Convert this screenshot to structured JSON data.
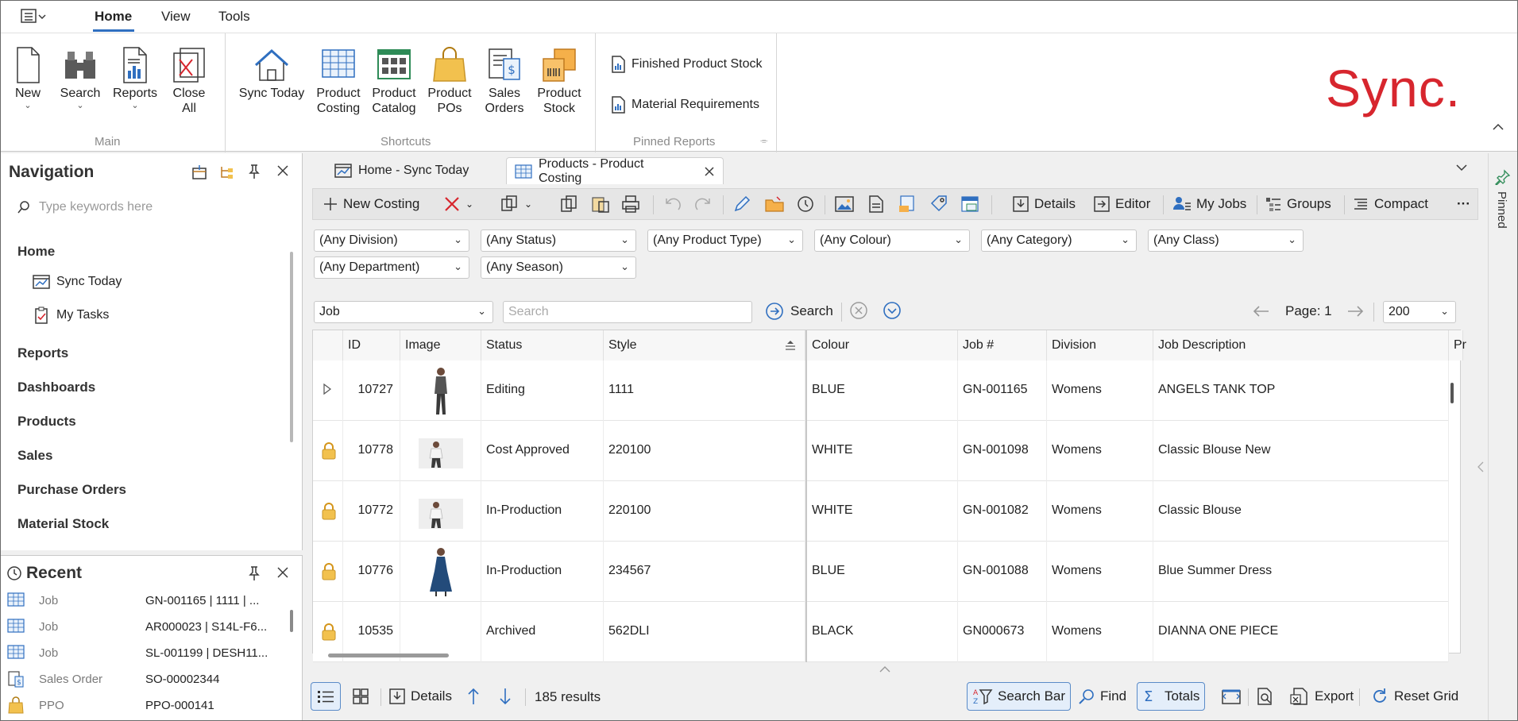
{
  "menubar": {
    "tabs": [
      {
        "label": "Home",
        "active": true
      },
      {
        "label": "View"
      },
      {
        "label": "Tools"
      }
    ]
  },
  "ribbon": {
    "main": {
      "label": "Main",
      "buttons": [
        {
          "label": "New",
          "icon": "new-document-icon",
          "dropdown": true
        },
        {
          "label": "Search",
          "icon": "binoculars-icon",
          "dropdown": true
        },
        {
          "label": "Reports",
          "icon": "report-icon",
          "dropdown": true
        },
        {
          "label": "Close\nAll",
          "icon": "close-all-icon"
        }
      ]
    },
    "shortcuts": {
      "label": "Shortcuts",
      "buttons": [
        {
          "label": "Sync Today",
          "icon": "house-icon"
        },
        {
          "label": "Product\nCosting",
          "icon": "grid-sheet-icon"
        },
        {
          "label": "Product\nCatalog",
          "icon": "catalog-icon"
        },
        {
          "label": "Product\nPOs",
          "icon": "shopping-bag-icon"
        },
        {
          "label": "Sales\nOrders",
          "icon": "sales-order-icon"
        },
        {
          "label": "Product\nStock",
          "icon": "stock-boxes-icon"
        }
      ]
    },
    "pinned": {
      "label": "Pinned Reports",
      "items": [
        "Finished Product Stock",
        "Material Requirements"
      ]
    },
    "brand": "Sync."
  },
  "navigation": {
    "title": "Navigation",
    "search_placeholder": "Type keywords here",
    "sections": [
      {
        "label": "Home",
        "children": [
          {
            "label": "Sync Today",
            "icon": "chart-window-icon"
          },
          {
            "label": "My Tasks",
            "icon": "clipboard-check-icon"
          }
        ]
      },
      {
        "label": "Reports"
      },
      {
        "label": "Dashboards"
      },
      {
        "label": "Products"
      },
      {
        "label": "Sales"
      },
      {
        "label": "Purchase Orders"
      },
      {
        "label": "Material Stock"
      }
    ]
  },
  "recent": {
    "title": "Recent",
    "items": [
      {
        "type": "Job",
        "value": "GN-001165 | 1111 | ...",
        "icon": "grid-sheet-icon"
      },
      {
        "type": "Job",
        "value": "AR000023 | S14L-F6...",
        "icon": "grid-sheet-icon"
      },
      {
        "type": "Job",
        "value": "SL-001199 | DESH11...",
        "icon": "grid-sheet-icon"
      },
      {
        "type": "Sales Order",
        "value": "SO-00002344",
        "icon": "sales-order-icon"
      },
      {
        "type": "PPO",
        "value": "PPO-000141",
        "icon": "shopping-bag-icon"
      }
    ]
  },
  "doc_tabs": [
    {
      "label": "Home - Sync Today",
      "icon": "chart-window-icon"
    },
    {
      "label": "Products - Product Costing",
      "icon": "grid-sheet-icon",
      "active": true
    }
  ],
  "toolbar": {
    "new_costing": "New Costing",
    "details": "Details",
    "editor": "Editor",
    "my_jobs": "My Jobs",
    "groups": "Groups",
    "compact": "Compact",
    "more": "···"
  },
  "filters": {
    "row1": [
      "(Any Division)",
      "(Any Status)",
      "(Any Product Type)",
      "(Any Colour)",
      "(Any Category)",
      "(Any Class)"
    ],
    "row2": [
      "(Any Department)",
      "(Any Season)"
    ]
  },
  "searchbar": {
    "field": "Job",
    "placeholder": "Search",
    "search_label": "Search",
    "page_label": "Page: 1",
    "page_size": "200"
  },
  "grid": {
    "columns": [
      "ID",
      "Image",
      "Status",
      "Style",
      "Colour",
      "Job #",
      "Division",
      "Job Description",
      "Pr"
    ],
    "rows": [
      {
        "lead": "expand",
        "id": "10727",
        "image": "model-tank-top",
        "status": "Editing",
        "style": "1111",
        "colour": "BLUE",
        "job": "GN-001165",
        "division": "Womens",
        "desc": "ANGELS TANK TOP"
      },
      {
        "lead": "lock",
        "id": "10778",
        "image": "model-blouse",
        "status": "Cost Approved",
        "style": "220100",
        "colour": "WHITE",
        "job": "GN-001098",
        "division": "Womens",
        "desc": "Classic Blouse New"
      },
      {
        "lead": "lock",
        "id": "10772",
        "image": "model-blouse",
        "status": "In-Production",
        "style": "220100",
        "colour": "WHITE",
        "job": "GN-001082",
        "division": "Womens",
        "desc": "Classic Blouse"
      },
      {
        "lead": "lock",
        "id": "10776",
        "image": "model-dress",
        "status": "In-Production",
        "style": "234567",
        "colour": "BLUE",
        "job": "GN-001088",
        "division": "Womens",
        "desc": "Blue Summer Dress"
      },
      {
        "lead": "lock",
        "id": "10535",
        "image": "",
        "status": "Archived",
        "style": "562DLI",
        "colour": "BLACK",
        "job": "GN000673",
        "division": "Womens",
        "desc": "DIANNA ONE PIECE"
      }
    ]
  },
  "statusbar": {
    "details": "Details",
    "results": "185 results",
    "search_bar": "Search Bar",
    "find": "Find",
    "totals": "Totals",
    "export": "Export",
    "reset_grid": "Reset Grid"
  },
  "side": {
    "pinned": "Pinned"
  },
  "colors": {
    "brand": "#d7262e",
    "accent": "#2f6fc0",
    "lock": "#e0a020"
  }
}
